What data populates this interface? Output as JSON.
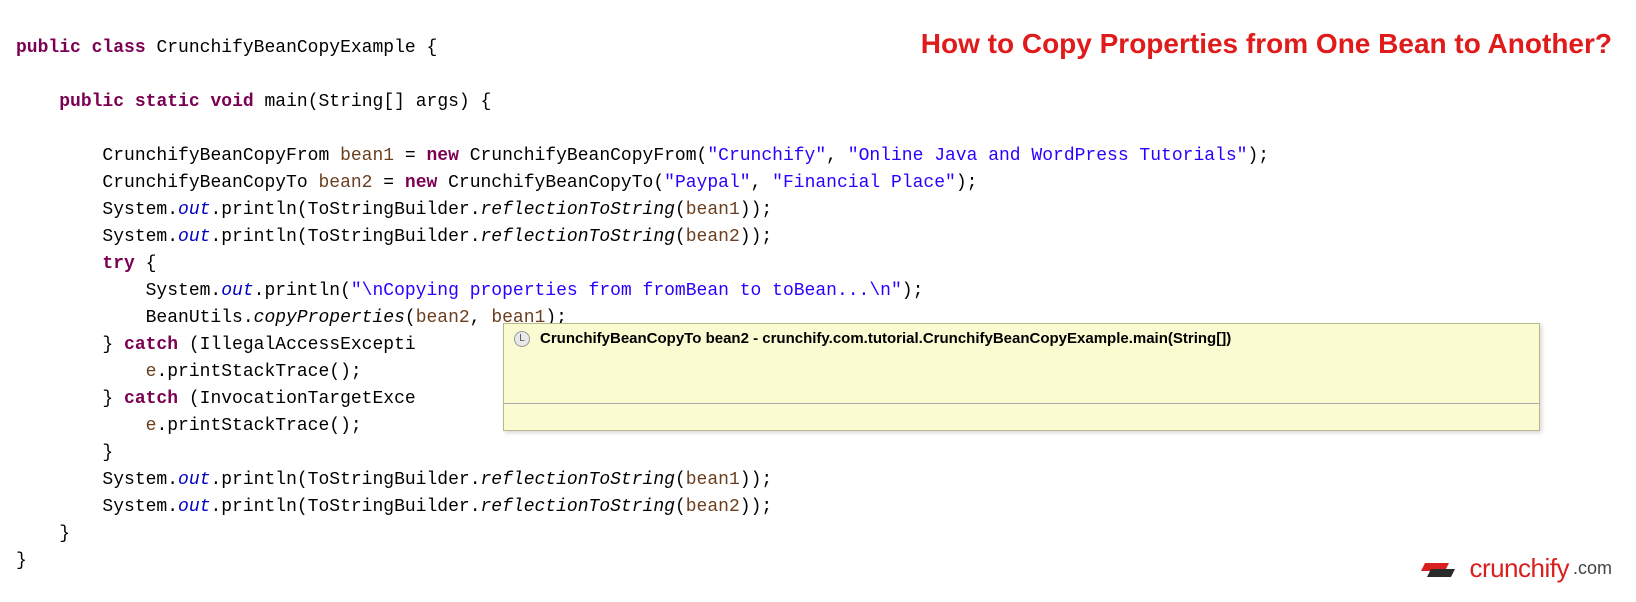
{
  "title": "How to Copy Properties from One Bean to Another?",
  "code": {
    "l1": {
      "kw1": "public",
      "kw2": "class",
      "name": "CrunchifyBeanCopyExample {"
    },
    "l2": "",
    "l3": {
      "kw1": "public",
      "kw2": "static",
      "kw3": "void",
      "method": "main(String[] args) {"
    },
    "l4": "",
    "l5": {
      "type": "CrunchifyBeanCopyFrom ",
      "var": "bean1",
      "eq": " = ",
      "kw": "new",
      "ctor": " CrunchifyBeanCopyFrom(",
      "s1": "\"Crunchify\"",
      "c1": ", ",
      "s2": "\"Online Java and WordPress Tutorials\"",
      "end": ");"
    },
    "l6": {
      "type": "CrunchifyBeanCopyTo ",
      "var": "bean2",
      "eq": " = ",
      "kw": "new",
      "ctor": " CrunchifyBeanCopyTo(",
      "s1": "\"Paypal\"",
      "c1": ", ",
      "s2": "\"Financial Place\"",
      "end": ");"
    },
    "l7": {
      "p1": "System.",
      "f": "out",
      "p2": ".println(ToStringBuilder.",
      "m": "reflectionToString",
      "p3": "(",
      "v": "bean1",
      "end": "));"
    },
    "l8": {
      "p1": "System.",
      "f": "out",
      "p2": ".println(ToStringBuilder.",
      "m": "reflectionToString",
      "p3": "(",
      "v": "bean2",
      "end": "));"
    },
    "l9": {
      "kw": "try",
      "end": " {"
    },
    "l10": {
      "p1": "System.",
      "f": "out",
      "p2": ".println(",
      "s": "\"\\nCopying properties from fromBean to toBean...\\n\"",
      "end": ");"
    },
    "l11": {
      "p1": "BeanUtils.",
      "m": "copyProperties",
      "p2": "(",
      "v1": "bean2",
      "c": ", ",
      "v2": "bean1",
      "end": ");"
    },
    "l12": {
      "p1": "} ",
      "kw": "catch",
      "p2": " (IllegalAccessExcepti"
    },
    "l13": {
      "v": "e",
      "end": ".printStackTrace();"
    },
    "l14": {
      "p1": "} ",
      "kw": "catch",
      "p2": " (InvocationTargetExce"
    },
    "l15": {
      "v": "e",
      "end": ".printStackTrace();"
    },
    "l16": "}",
    "l17": {
      "p1": "System.",
      "f": "out",
      "p2": ".println(ToStringBuilder.",
      "m": "reflectionToString",
      "p3": "(",
      "v": "bean1",
      "end": "));"
    },
    "l18": {
      "p1": "System.",
      "f": "out",
      "p2": ".println(ToStringBuilder.",
      "m": "reflectionToString",
      "p3": "(",
      "v": "bean2",
      "end": "));"
    },
    "l19": "}",
    "l20": "}"
  },
  "tooltip": {
    "text": "CrunchifyBeanCopyTo bean2 - crunchify.com.tutorial.CrunchifyBeanCopyExample.main(String[])"
  },
  "logo": {
    "name": "crunchify",
    "ext": ".com"
  }
}
